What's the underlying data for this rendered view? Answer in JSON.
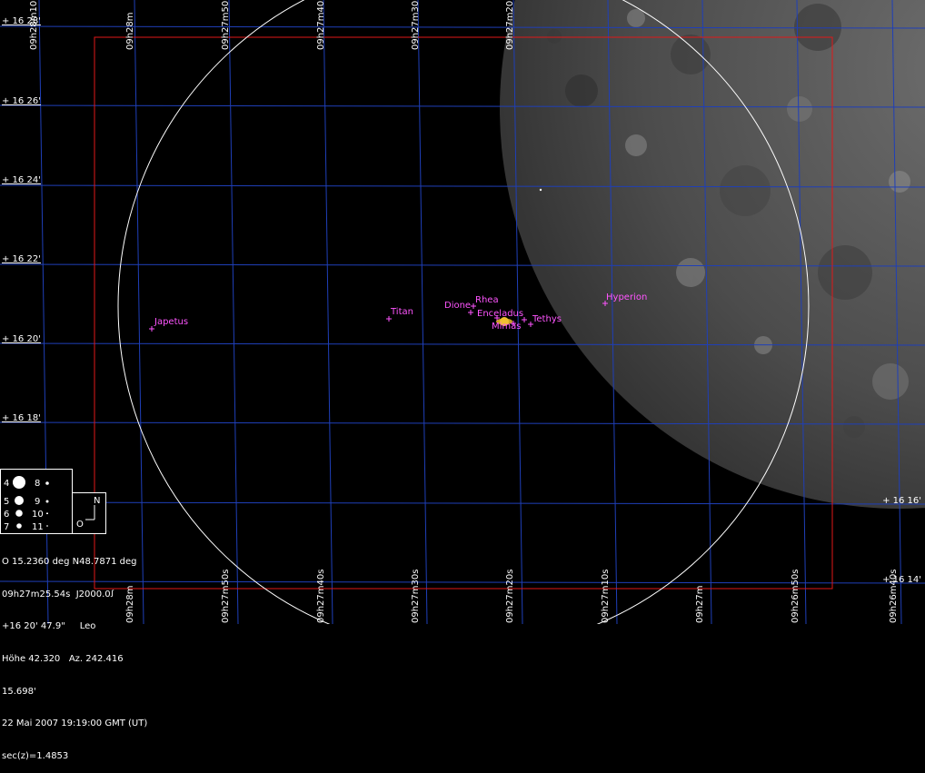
{
  "sky_chart": {
    "ra_labels_top": [
      "09h28m10",
      "09h28m",
      "09h27m50",
      "09h27m40",
      "09h27m30",
      "09h27m20"
    ],
    "ra_labels_bottom": [
      "09h28m",
      "09h27m50s",
      "09h27m40s",
      "09h27m30s",
      "09h27m20s",
      "09h27m10s",
      "09h27m",
      "09h26m50s",
      "09h26m40s"
    ],
    "dec_labels_left": [
      "+ 16 28'",
      "+ 16 26'",
      "+ 16 24'",
      "+ 16 22'",
      "+ 16 20'",
      "+ 16 18'"
    ],
    "dec_labels_right": [
      "+ 16 16'",
      "+ 16 14'"
    ],
    "planet": "Saturn",
    "moons": [
      {
        "name": "Japetus",
        "label": "Japetus"
      },
      {
        "name": "Titan",
        "label": "Titan"
      },
      {
        "name": "Dione",
        "label": "Dione"
      },
      {
        "name": "Rhea",
        "label": "Rhea"
      },
      {
        "name": "Enceladus",
        "label": "Enceladus"
      },
      {
        "name": "Mimas",
        "label": "Mimas"
      },
      {
        "name": "Tethys",
        "label": "Tethys"
      },
      {
        "name": "Hyperion",
        "label": "Hyperion"
      }
    ],
    "colors": {
      "background": "#000000",
      "grid": "#1f3fb8",
      "frame": "#e01818",
      "fov_circle": "#ffffff",
      "moon_label": "#ff55ff",
      "planet": "#f0c030",
      "lunar_surface": "#5a5a5a"
    }
  },
  "legend": {
    "magnitudes": [
      "4",
      "5",
      "6",
      "7",
      "8",
      "9",
      "10",
      "11"
    ],
    "compass_north": "N",
    "compass_east": "O"
  },
  "info": {
    "line1": "O 15.2360 deg N48.7871 deg",
    "line2": "09h27m25.54s  J2000.0ꭍ",
    "line3": "+16 20' 47.9\"     Leo",
    "line4": "Höhe 42.320   Az. 242.416",
    "line5": "15.698'",
    "line6": "22 Mai 2007 19:19:00 GMT (UT)",
    "line7": "sec(z)=1.4853"
  }
}
